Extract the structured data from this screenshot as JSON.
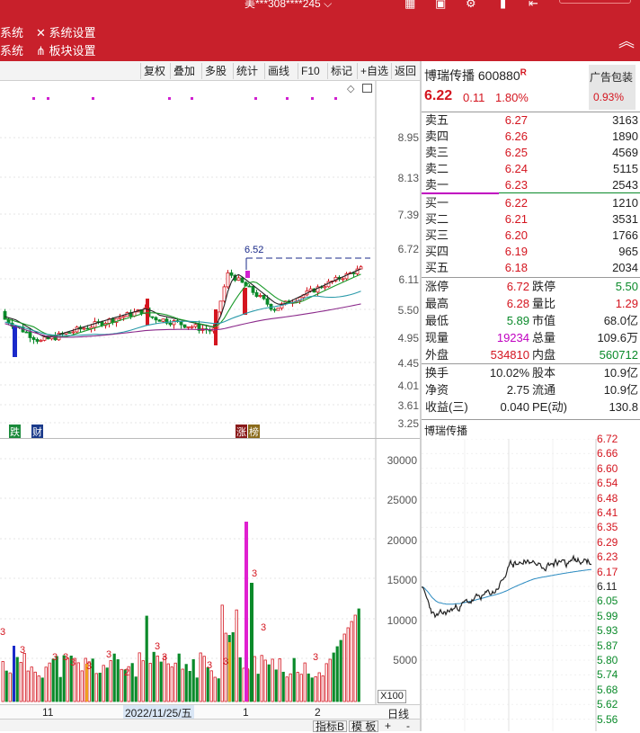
{
  "titlebar": {
    "user": "美***308****245 ⌵"
  },
  "menu": {
    "row1": {
      "left": "系统",
      "item": "系统设置"
    },
    "row2": {
      "left": "系统",
      "item": "板块设置"
    }
  },
  "toolbar": {
    "buttons": [
      "复权",
      "叠加",
      "多股",
      "统计",
      "画线",
      "F10",
      "标记",
      "+自选",
      "返回"
    ]
  },
  "kline": {
    "price_axis": [
      "8.95",
      "8.13",
      "7.39",
      "6.72",
      "6.11",
      "5.50",
      "4.95",
      "4.45",
      "4.01",
      "3.61",
      "3.25"
    ],
    "high_marker": "6.52",
    "markers": {
      "left1": "跌",
      "left2": "财",
      "right1": "涨",
      "right2": "榜"
    }
  },
  "volume": {
    "axis": [
      "30000",
      "25000",
      "20000",
      "15000",
      "10000",
      "5000"
    ],
    "unit": "X100",
    "date_axis": {
      "m1": "11",
      "date": "2022/11/25/五",
      "m2": "1",
      "m3": "2"
    },
    "footer": {
      "period": "日线",
      "tab1": "指标B",
      "tab2": "模 板",
      "plus": "+",
      "minus": "-"
    },
    "bar_label": "3",
    "small_label": "2"
  },
  "quote": {
    "name": "博瑞传播",
    "code": "600880",
    "flag": "R",
    "ad_label": "广告包装",
    "ad_pct": "0.93%",
    "price": "6.22",
    "change": "0.11",
    "pct": "1.80%",
    "asks": [
      {
        "name": "卖五",
        "price": "6.27",
        "vol": "3163"
      },
      {
        "name": "卖四",
        "price": "6.26",
        "vol": "1890"
      },
      {
        "name": "卖三",
        "price": "6.25",
        "vol": "4569"
      },
      {
        "name": "卖二",
        "price": "6.24",
        "vol": "5115"
      },
      {
        "name": "卖一",
        "price": "6.23",
        "vol": "2543"
      }
    ],
    "bids": [
      {
        "name": "买一",
        "price": "6.22",
        "vol": "1210"
      },
      {
        "name": "买二",
        "price": "6.21",
        "vol": "3531"
      },
      {
        "name": "买三",
        "price": "6.20",
        "vol": "1766"
      },
      {
        "name": "买四",
        "price": "6.19",
        "vol": "965"
      },
      {
        "name": "买五",
        "price": "6.18",
        "vol": "2034"
      }
    ],
    "stats": [
      {
        "l1": "涨停",
        "v1": "6.72",
        "l2": "跌停",
        "v2": "5.50"
      },
      {
        "l1": "最高",
        "v1": "6.28",
        "l2": "量比",
        "v2": "1.29"
      },
      {
        "l1": "最低",
        "v1": "5.89",
        "l2": "市值",
        "v2": "68.0亿"
      },
      {
        "l1": "现量",
        "v1": "19234",
        "l2": "总量",
        "v2": "109.6万"
      },
      {
        "l1": "外盘",
        "v1": "534810",
        "l2": "内盘",
        "v2": "560712"
      }
    ],
    "stats2": [
      {
        "l1": "换手",
        "v1": "10.02%",
        "l2": "股本",
        "v2": "10.9亿"
      },
      {
        "l1": "净资",
        "v1": "2.75",
        "l2": "流通",
        "v2": "10.9亿"
      },
      {
        "l1": "收益(三)",
        "v1": "0.040",
        "l2": "PE(动)",
        "v2": "130.8"
      }
    ]
  },
  "intraday": {
    "title": "博瑞传播",
    "axis": [
      "6.72",
      "6.66",
      "6.60",
      "6.54",
      "6.48",
      "6.41",
      "6.35",
      "6.29",
      "6.23",
      "6.17",
      "6.11",
      "6.05",
      "5.99",
      "5.93",
      "5.87",
      "5.80",
      "5.74",
      "5.68",
      "5.62",
      "5.56"
    ]
  },
  "colors": {
    "up": "#d4151f",
    "down": "#0a8a2a",
    "ma_purple": "#8b2a8b",
    "ma_teal": "#2a9aaa",
    "brand": "#c8202b"
  }
}
